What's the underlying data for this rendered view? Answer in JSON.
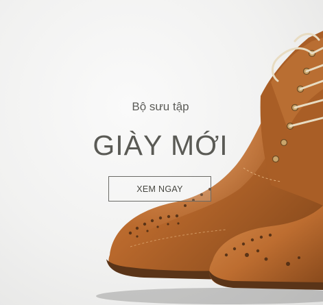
{
  "banner": {
    "subtitle": "Bộ sưu tập",
    "title": "GIÀY MỚI",
    "cta_label": "XEM NGAY"
  },
  "image": {
    "subject": "brown-leather-brogue-boots-icon"
  },
  "colors": {
    "background": "#f0f0ef",
    "text": "#5a5a55",
    "leather": "#b8682c",
    "sole": "#5a3418"
  }
}
